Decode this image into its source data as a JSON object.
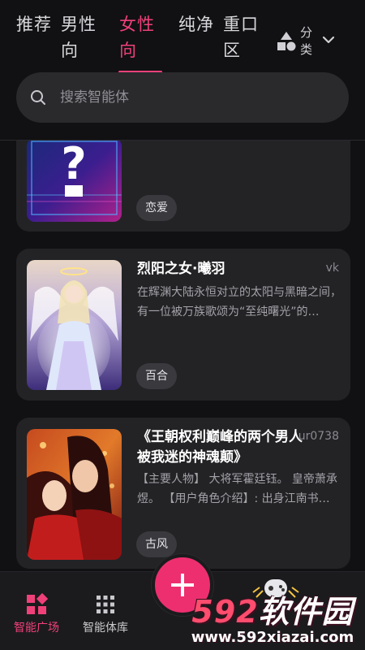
{
  "tabs": [
    {
      "label": "推荐"
    },
    {
      "label": "男性向"
    },
    {
      "label": "女性向"
    },
    {
      "label": "纯净"
    },
    {
      "label": "重口区"
    }
  ],
  "active_tab": "女性向",
  "category": {
    "label": "分类",
    "icon": "shapes-icon"
  },
  "search": {
    "placeholder": "搜索智能体"
  },
  "cards": [
    {
      "title": "",
      "author": "",
      "description": "",
      "tag": "恋爱",
      "cover": "question-mark-cover"
    },
    {
      "title": "烈阳之女·曦羽",
      "author": "vk",
      "description": "在辉渊大陆永恒对立的太阳与黑暗之间，有一位被万族歌颂为“至纯曙光”的…",
      "tag": "百合",
      "cover": "angel-girl-cover"
    },
    {
      "title": "《王朝权利巅峰的两个男人被我迷的神魂颠》",
      "author": "ur0738",
      "description": "【主要人物】 大将军霍廷钰。 皇帝萧承煜。 【用户角色介绍】: 出身江南书…",
      "tag": "古风",
      "cover": "two-men-cover"
    }
  ],
  "bottom_nav": [
    {
      "label": "智能广场",
      "icon": "grid-icon",
      "active": true
    },
    {
      "label": "智能体库",
      "icon": "dots-grid-icon",
      "active": false
    }
  ],
  "fab": {
    "label": "+"
  },
  "watermark": {
    "brand_num": "592",
    "brand_text": "软件园",
    "url": "www.592xiazai.com"
  },
  "colors": {
    "accent": "#f0407a",
    "background": "#111113",
    "card": "#232326"
  }
}
